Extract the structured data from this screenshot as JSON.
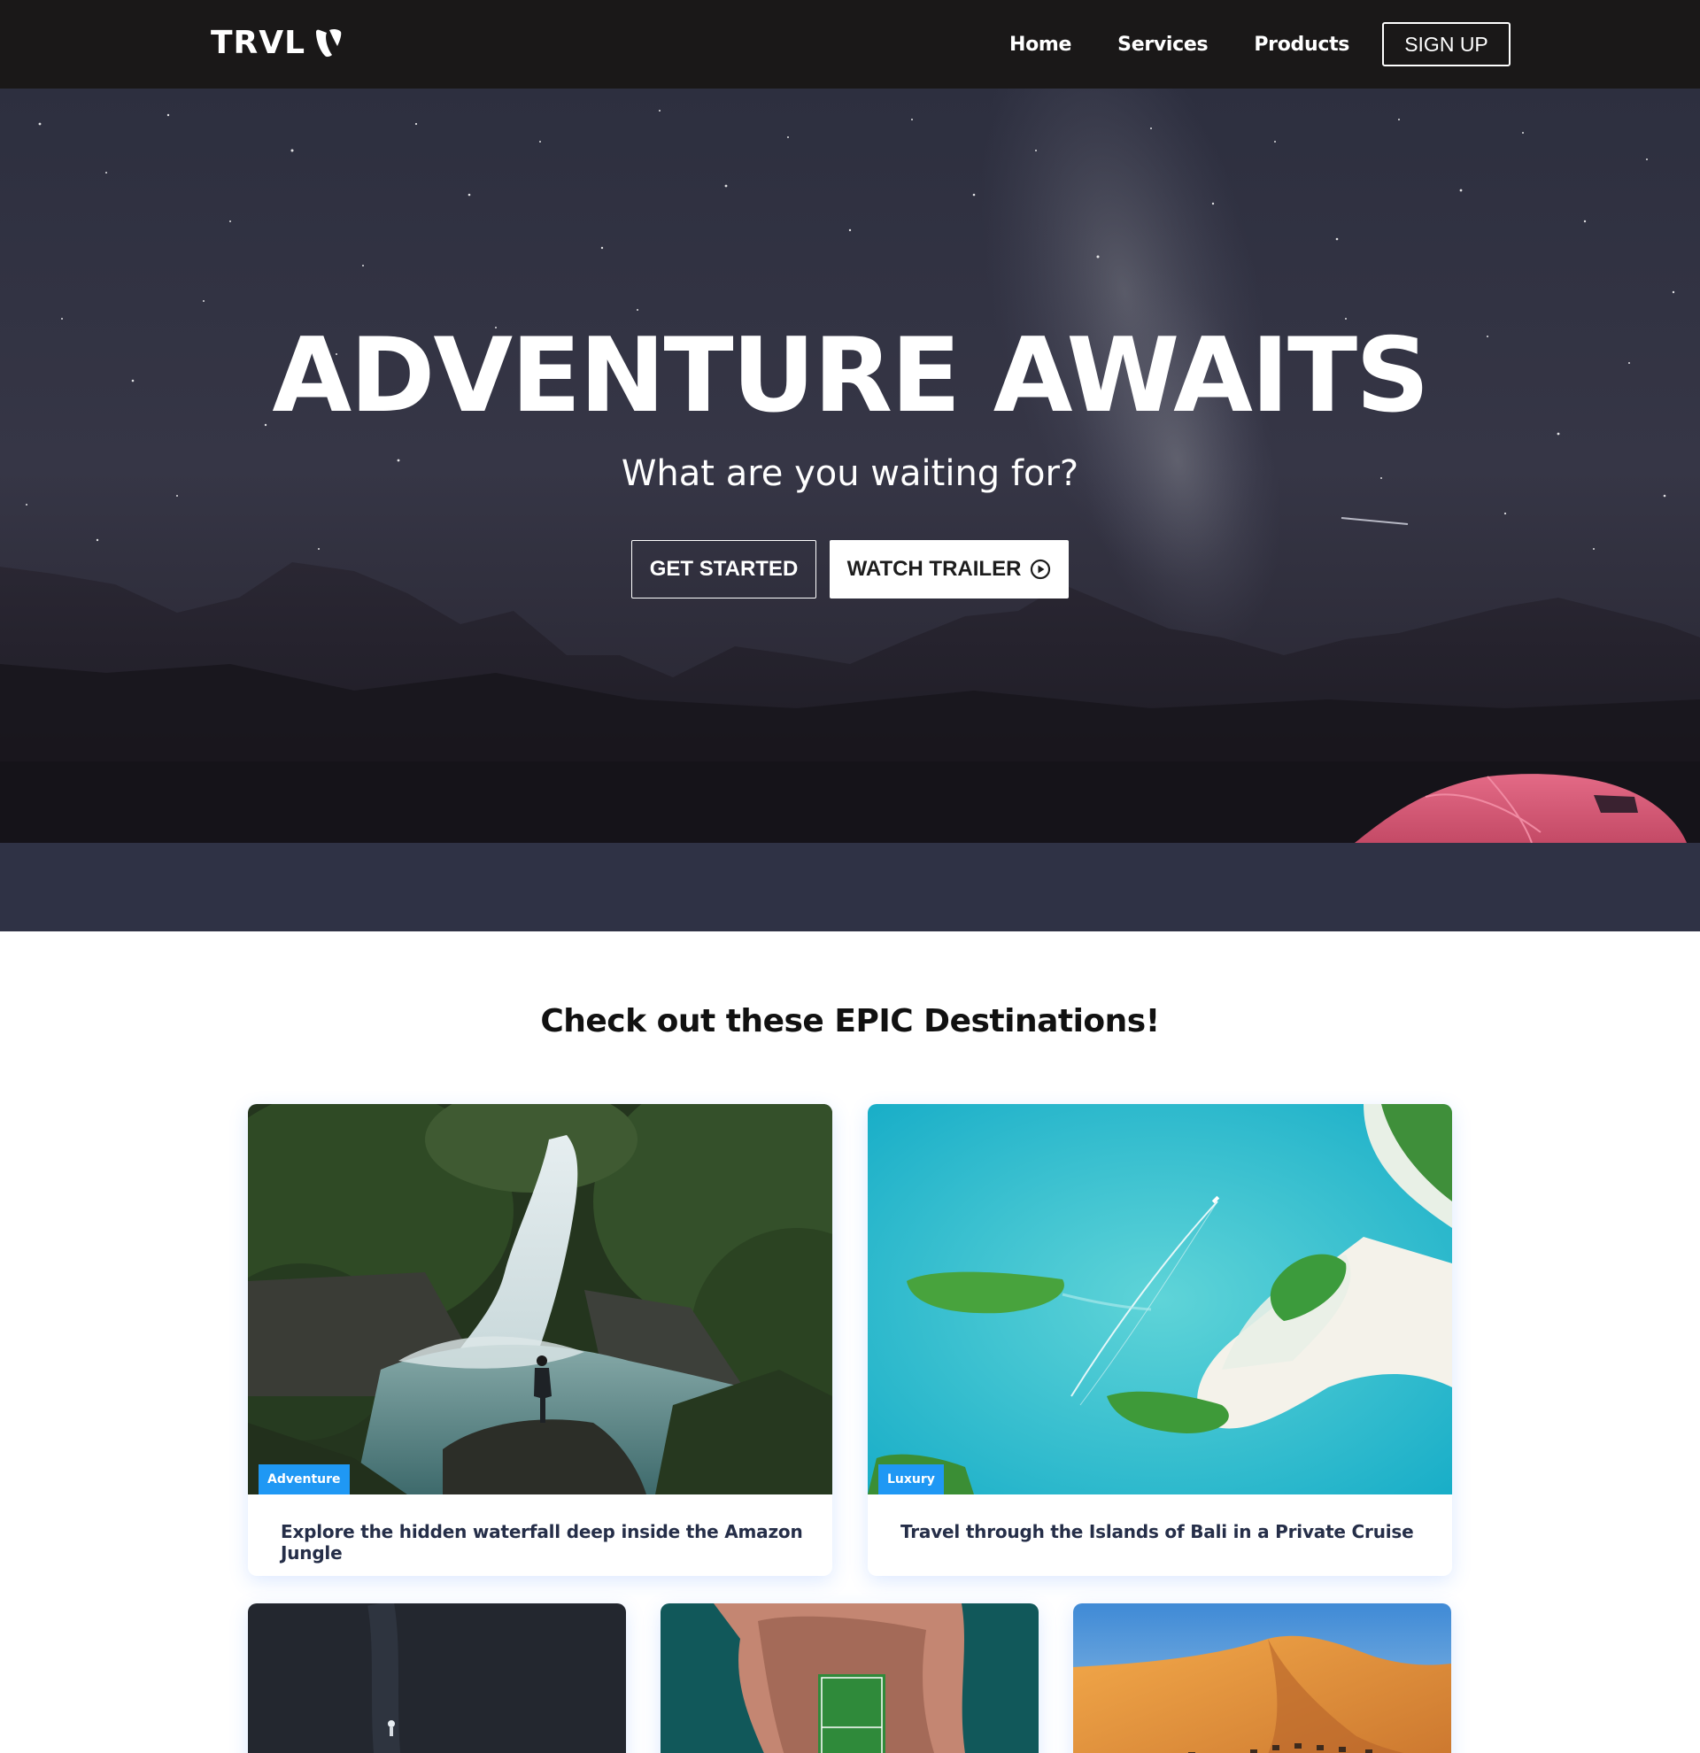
{
  "navbar": {
    "logo_text": "TRVL",
    "logo_icon": "typo3-icon",
    "links": [
      "Home",
      "Services",
      "Products"
    ],
    "signup_label": "SIGN UP"
  },
  "hero": {
    "title": "ADVENTURE AWAITS",
    "subtitle": "What are you waiting for?",
    "get_started_label": "GET STARTED",
    "watch_trailer_label": "WATCH TRAILER",
    "watch_trailer_icon": "play-circle-icon"
  },
  "destinations": {
    "heading": "Check out these EPIC Destinations!",
    "cards": [
      {
        "label": "Adventure",
        "text": "Explore the hidden waterfall deep inside the Amazon Jungle",
        "image": "waterfall"
      },
      {
        "label": "Luxury",
        "text": "Travel through the Islands of Bali in a Private Cruise",
        "image": "islands"
      },
      {
        "label": "",
        "text": "",
        "image": "dark-sea"
      },
      {
        "label": "",
        "text": "",
        "image": "island-stadium"
      },
      {
        "label": "",
        "text": "",
        "image": "desert"
      }
    ]
  },
  "colors": {
    "navbar_bg": "#1a1818",
    "badge_bg": "#1f98f4",
    "card_text": "#252e48"
  }
}
